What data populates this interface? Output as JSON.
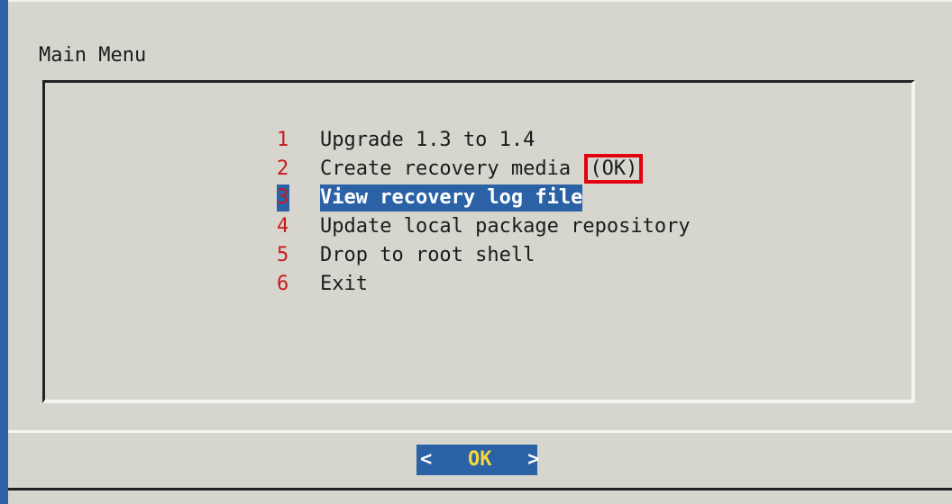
{
  "dialog": {
    "title": "Main Menu"
  },
  "menu": {
    "items": [
      {
        "key": "1",
        "label": "Upgrade 1.3 to 1.4",
        "note": ""
      },
      {
        "key": "2",
        "label": "Create recovery media",
        "note": "(OK)"
      },
      {
        "key": "3",
        "label": "View recovery log file",
        "note": ""
      },
      {
        "key": "4",
        "label": "Update local package repository",
        "note": ""
      },
      {
        "key": "5",
        "label": "Drop to root shell",
        "note": ""
      },
      {
        "key": "6",
        "label": "Exit",
        "note": ""
      }
    ],
    "selected_index": 2
  },
  "buttons": {
    "ok": {
      "left": "<",
      "label": "OK",
      "right": ">"
    }
  },
  "colors": {
    "background": "#d6d6ce",
    "selection": "#2b62a6",
    "hotkey": "#c8191a",
    "button_text": "#f4d63c",
    "annotation_box": "#e3000f"
  }
}
